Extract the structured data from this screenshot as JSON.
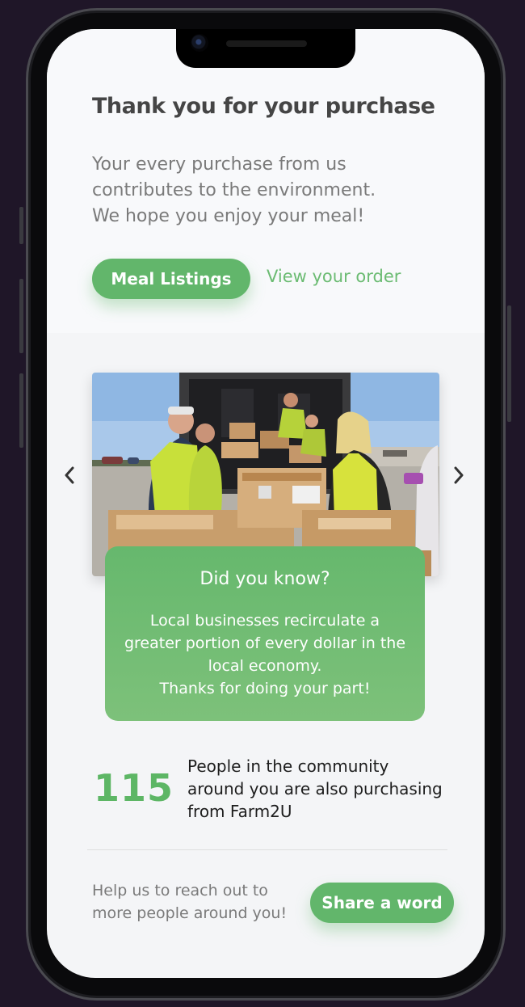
{
  "header": {
    "title": "Thank you for your purchase",
    "subtitle_lines": [
      "Your every purchase from us",
      "contributes to the environment.",
      "We hope you enjoy your meal!"
    ]
  },
  "actions": {
    "meal_listings_label": "Meal Listings",
    "view_order_label": "View your order"
  },
  "carousel": {
    "image_alt": "Volunteers in yellow safety vests unpacking food boxes from a truck",
    "prev_icon": "chevron-left-icon",
    "next_icon": "chevron-right-icon"
  },
  "info_card": {
    "title": "Did you know?",
    "body_lines": [
      "Local businesses recirculate a",
      "greater portion of every dollar in the",
      "local economy.",
      "Thanks for doing your part!"
    ]
  },
  "stat": {
    "count": "115",
    "text_lines": [
      "People in the community",
      "around you are also purchasing",
      "from Farm2U"
    ]
  },
  "footer": {
    "text_lines": [
      "Help us to reach out to",
      "more people around you!"
    ],
    "share_label": "Share a word"
  },
  "colors": {
    "accent_green": "#62b66b",
    "card_gradient_top": "#66b86d",
    "card_gradient_bottom": "#7dc17a",
    "background": "#1f1628"
  }
}
